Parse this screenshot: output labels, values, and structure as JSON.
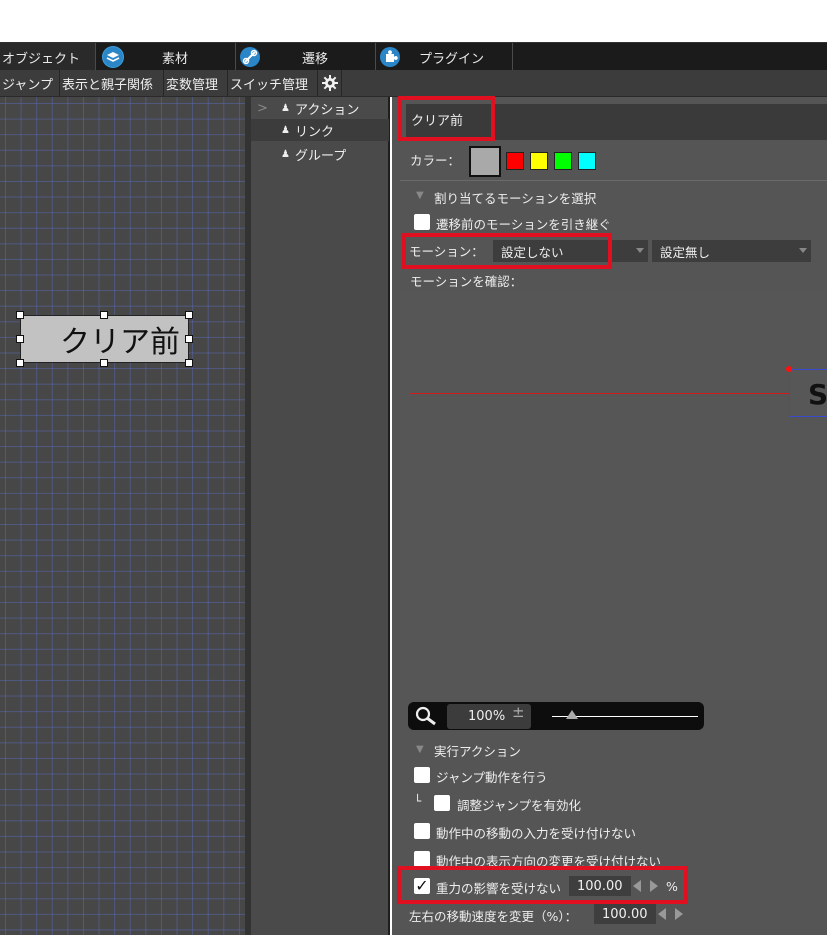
{
  "topbar": {
    "tabs": [
      {
        "label": "オブジェクト"
      },
      {
        "label": "素材",
        "icon": "layers-icon"
      },
      {
        "label": "遷移",
        "icon": "link-icon"
      },
      {
        "label": "プラグイン",
        "icon": "puzzle-icon"
      }
    ]
  },
  "subtabs": [
    "ジャンプ",
    "表示と親子関係",
    "変数管理",
    "スイッチ管理"
  ],
  "settings_icon": "gear-icon",
  "canvas": {
    "object_label": "クリア前"
  },
  "midlist": {
    "items": [
      {
        "label": "アクション",
        "expander": ">"
      },
      {
        "label": "リンク"
      },
      {
        "label": "グループ"
      }
    ]
  },
  "panel": {
    "name_value": "クリア前",
    "color_label": "カラー：",
    "colors": [
      "#a9a9a9",
      "#ff0000",
      "#ffff00",
      "#00ff00",
      "#00ffff"
    ],
    "motion_section": "割り当てるモーションを選択",
    "inherit_motion_label": "遷移前のモーションを引き継ぐ",
    "motion_label": "モーション：",
    "motion_value": "設定しない",
    "motion_value2": "設定無し",
    "motion_check_label": "モーションを確認：",
    "preview_letter": "S",
    "zoom_value": "100%",
    "zoom_plusminus": "±",
    "action_section": "実行アクション",
    "jump_label": "ジャンプ動作を行う",
    "adjust_jump_prefix": "└",
    "adjust_jump_label": "調整ジャンプを有効化",
    "ignore_move_label": "動作中の移動の入力を受け付けない",
    "ignore_dir_label": "動作中の表示方向の変更を受け付けない",
    "gravity_label": "重力の影響を受けない",
    "gravity_checkmark": "✓",
    "gravity_value": "100.00",
    "gravity_unit": "%",
    "speed_label": "左右の移動速度を変更（%）：",
    "speed_value": "100.00"
  }
}
